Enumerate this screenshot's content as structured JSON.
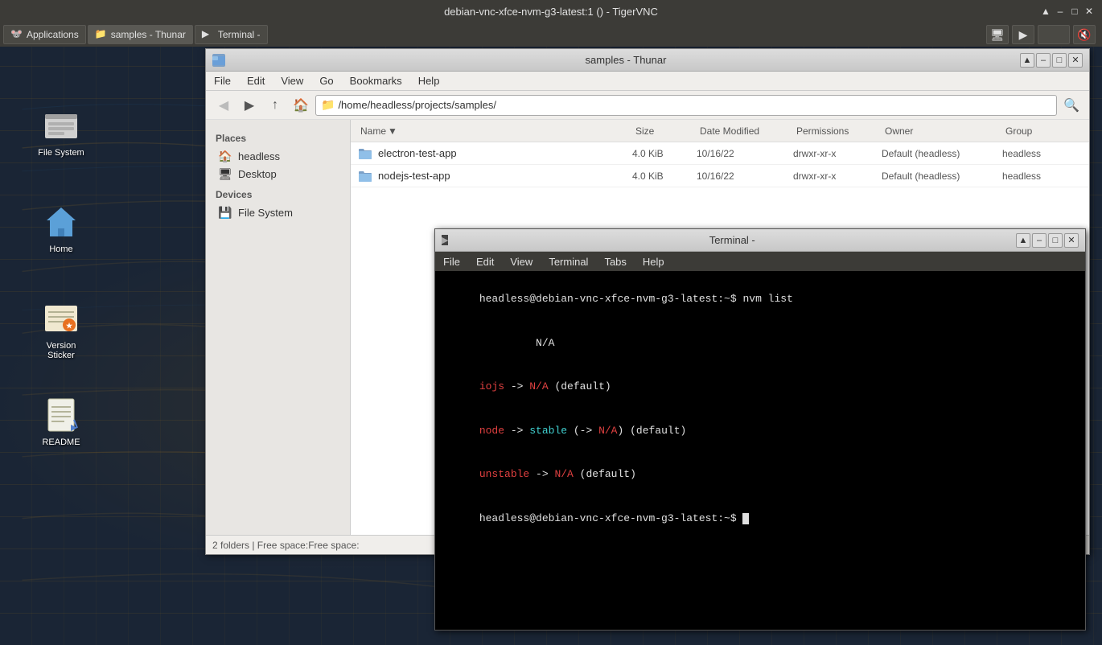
{
  "vnc": {
    "title": "debian-vnc-xfce-nvm-g3-latest:1 () - TigerVNC",
    "controls": [
      "▲",
      "–",
      "□",
      "✕"
    ]
  },
  "taskbar": {
    "apps_label": "Applications",
    "thunar_tab": "samples - Thunar",
    "terminal_tab": "Terminal -",
    "center_title": ""
  },
  "desktop": {
    "icons": [
      {
        "id": "filesystem",
        "label": "File System"
      },
      {
        "id": "home",
        "label": "Home"
      },
      {
        "id": "version-sticker",
        "label": "Version\nSticker"
      },
      {
        "id": "readme",
        "label": "README"
      }
    ]
  },
  "thunar": {
    "title": "samples - Thunar",
    "location": "/home/headless/projects/samples/",
    "menu": [
      "File",
      "Edit",
      "View",
      "Go",
      "Bookmarks",
      "Help"
    ],
    "columns": {
      "name": "Name",
      "size": "Size",
      "date": "Date Modified",
      "permissions": "Permissions",
      "owner": "Owner",
      "group": "Group"
    },
    "sidebar": {
      "places_header": "Places",
      "places": [
        {
          "label": "headless",
          "icon": "🏠"
        },
        {
          "label": "Desktop",
          "icon": "🖥"
        }
      ],
      "devices_header": "Devices",
      "devices": [
        {
          "label": "File System",
          "icon": "💾"
        }
      ]
    },
    "files": [
      {
        "name": "electron-test-app",
        "size": "4.0 KiB",
        "date": "10/16/22",
        "permissions": "drwxr-xr-x",
        "owner": "Default (headless)",
        "group": "headless"
      },
      {
        "name": "nodejs-test-app",
        "size": "4.0 KiB",
        "date": "10/16/22",
        "permissions": "drwxr-xr-x",
        "owner": "Default (headless)",
        "group": "headless"
      }
    ],
    "statusbar": "2 folders  |  Free space: "
  },
  "terminal": {
    "title": "Terminal -",
    "menu": [
      "File",
      "Edit",
      "View",
      "Terminal",
      "Tabs",
      "Help"
    ],
    "lines": [
      {
        "type": "prompt_cmd",
        "text": "headless@debian-vnc-xfce-nvm-g3-latest:~$ nvm list"
      },
      {
        "type": "blank",
        "text": "          N/A"
      },
      {
        "type": "error_line",
        "parts": [
          {
            "color": "red",
            "text": "iojs"
          },
          {
            "color": "white",
            "text": " -> "
          },
          {
            "color": "red",
            "text": "N/A"
          },
          {
            "color": "white",
            "text": " (default)"
          }
        ]
      },
      {
        "type": "mixed_line",
        "parts": [
          {
            "color": "red",
            "text": "node"
          },
          {
            "color": "white",
            "text": " -> "
          },
          {
            "color": "cyan",
            "text": "stable"
          },
          {
            "color": "white",
            "text": " (-> "
          },
          {
            "color": "red",
            "text": "N/A"
          },
          {
            "color": "white",
            "text": ") (default)"
          }
        ]
      },
      {
        "type": "mixed_line",
        "parts": [
          {
            "color": "red",
            "text": "unstable"
          },
          {
            "color": "white",
            "text": " -> "
          },
          {
            "color": "red",
            "text": "N/A"
          },
          {
            "color": "white",
            "text": " (default)"
          }
        ]
      },
      {
        "type": "prompt_only",
        "text": "headless@debian-vnc-xfce-nvm-g3-latest:~$ "
      }
    ]
  }
}
